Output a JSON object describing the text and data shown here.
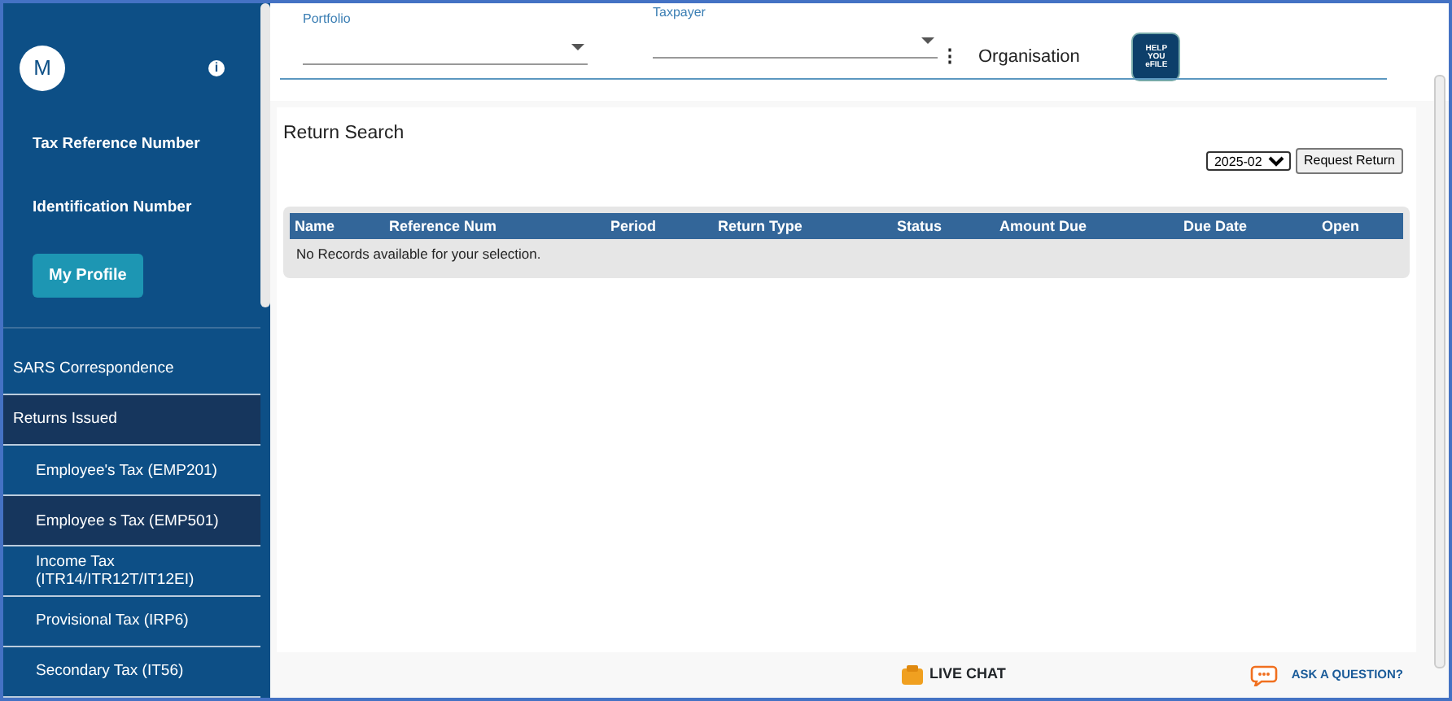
{
  "sidebar": {
    "avatar": "M",
    "info_icon": "i",
    "labels": [
      "Tax Reference Number",
      "Identification Number"
    ],
    "profile_button": "My Profile",
    "items": [
      {
        "label": "SARS Correspondence",
        "selected": false
      },
      {
        "label": "Returns Issued",
        "selected": true,
        "children": [
          {
            "label": "Employee's Tax (EMP201)",
            "selected": false
          },
          {
            "label": "Employee s Tax (EMP501)",
            "selected": true
          },
          {
            "label": "Income Tax (ITR14/ITR12T/IT12EI)",
            "selected": false
          },
          {
            "label": "Provisional Tax (IRP6)",
            "selected": false
          },
          {
            "label": "Secondary Tax (IT56)",
            "selected": false
          }
        ]
      }
    ]
  },
  "header": {
    "portfolio": {
      "label": "Portfolio"
    },
    "taxpayer": {
      "label": "Taxpayer"
    },
    "kebab": "⋮",
    "organisation": "Organisation",
    "logo_text": [
      "HELP",
      "YOU",
      "eFILE"
    ]
  },
  "return_search": {
    "title": "Return Search",
    "period": "2025-02",
    "request_button": "Request Return",
    "table": {
      "columns": [
        "Name",
        "Reference Num",
        "Period",
        "Return Type",
        "Status",
        "Amount Due",
        "Due Date",
        "Open"
      ],
      "empty_message": "No Records available for your selection."
    }
  },
  "footer": {
    "live_chat": "LIVE CHAT",
    "ask": "ASK A QUESTION?"
  }
}
